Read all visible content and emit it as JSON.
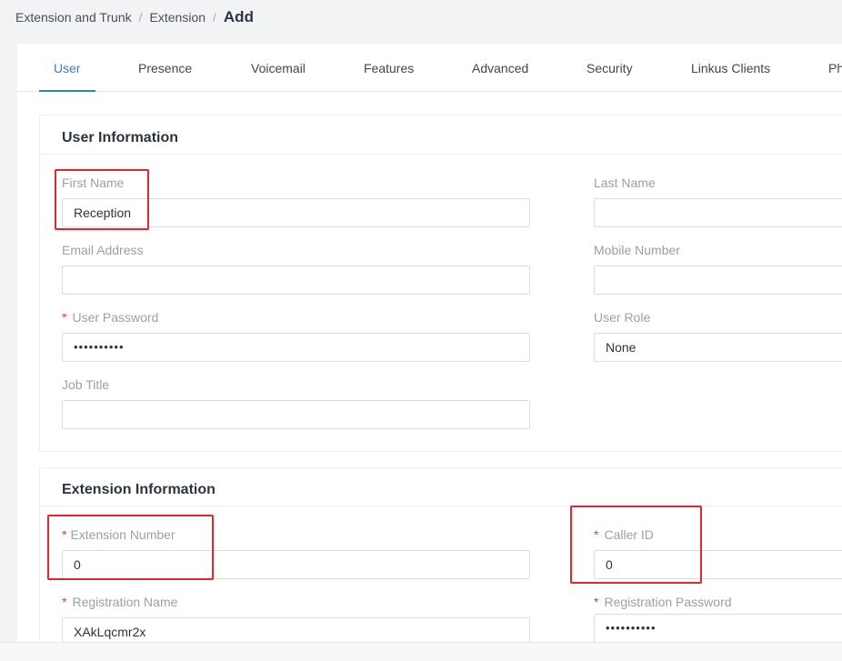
{
  "breadcrumb": {
    "items": [
      "Extension and Trunk",
      "Extension"
    ],
    "separator": "/",
    "current": "Add"
  },
  "tabs": [
    "User",
    "Presence",
    "Voicemail",
    "Features",
    "Advanced",
    "Security",
    "Linkus Clients",
    "Ph"
  ],
  "active_tab": "User",
  "user_info": {
    "title": "User Information",
    "first_name": {
      "label": "First Name",
      "value": "Reception"
    },
    "last_name": {
      "label": "Last Name",
      "value": ""
    },
    "email": {
      "label": "Email Address",
      "value": ""
    },
    "mobile": {
      "label": "Mobile Number",
      "value": ""
    },
    "user_password": {
      "label": "User Password",
      "value": "••••••••••",
      "required": "*"
    },
    "user_role": {
      "label": "User Role",
      "value": "None"
    },
    "job_title": {
      "label": "Job Title",
      "value": ""
    }
  },
  "extension_info": {
    "title": "Extension Information",
    "extension_number": {
      "label": "Extension Number",
      "value": "0",
      "required": "*"
    },
    "caller_id": {
      "label": "Caller ID",
      "value": "0",
      "required": "*"
    },
    "registration_name": {
      "label": "Registration Name",
      "value": "XAkLqcmr2x",
      "required": "*"
    },
    "registration_password": {
      "label": "Registration Password",
      "value": "••••••••••",
      "required": "*"
    }
  },
  "colors": {
    "accent": "#2f7fd8",
    "required": "#e0393e",
    "highlight_box": "#e5262b",
    "label": "#9aa0a8",
    "background": "#f2f3f5"
  }
}
